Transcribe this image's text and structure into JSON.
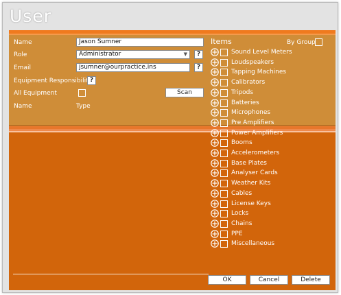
{
  "window": {
    "title": "User"
  },
  "form": {
    "name_label": "Name",
    "name_value": "Jason Sumner",
    "role_label": "Role",
    "role_value": "Administrator",
    "email_label": "Email",
    "email_value": "jsumner@ourpractice.ins",
    "help_glyph": "?",
    "equipment_responsibility_label": "Equipment Responsibility",
    "all_equipment_label": "All Equipment",
    "scan_label": "Scan",
    "col_name": "Name",
    "col_type": "Type"
  },
  "items_panel": {
    "title": "Items",
    "by_group_label": "By Group",
    "items": [
      "Sound Level Meters",
      "Loudspeakers",
      "Tapping Machines",
      "Calibrators",
      "Tripods",
      "Batteries",
      "Microphones",
      "Pre Amplifiers",
      "Power Amplifiers",
      "Booms",
      "Accelerometers",
      "Base Plates",
      "Analyser Cards",
      "Weather Kits",
      "Cables",
      "License Keys",
      "Locks",
      "Chains",
      "PPE",
      "Miscellaneous"
    ]
  },
  "footer": {
    "ok_label": "OK",
    "cancel_label": "Cancel",
    "delete_label": "Delete"
  },
  "colors": {
    "panel": "#d2650b",
    "gold_band": "#cf8d38",
    "accent_bar": "#f07a1e"
  },
  "icons": {
    "expander": "expand-plus-icon",
    "dropdown": "chevron-down-icon"
  }
}
